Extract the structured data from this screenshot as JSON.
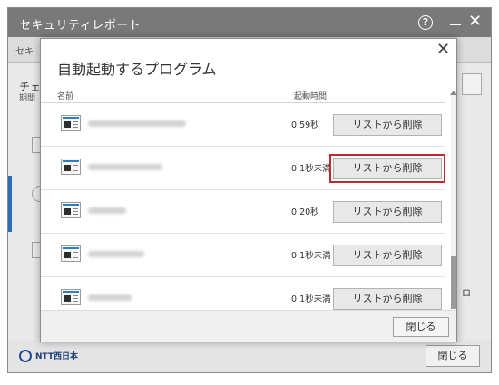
{
  "window": {
    "title": "セキュリティレポート",
    "help_glyph": "?",
    "close_glyph": "✕",
    "background": {
      "tab_label": "セキ",
      "heading": "チェ",
      "subtext": "期間",
      "side_text": "ロ"
    },
    "footer": {
      "brand": "NTT西日本",
      "close_label": "閉じる"
    }
  },
  "dialog": {
    "title": "自動起動するプログラム",
    "close_glyph": "✕",
    "columns": {
      "name": "名前",
      "time": "起動時間"
    },
    "rows": [
      {
        "time": "0.59秒",
        "action": "リストから削除"
      },
      {
        "time": "0.1秒未満",
        "action": "リストから削除"
      },
      {
        "time": "0.20秒",
        "action": "リストから削除"
      },
      {
        "time": "0.1秒未満",
        "action": "リストから削除"
      },
      {
        "time": "0.1秒未満",
        "action": "リストから削除"
      }
    ],
    "close_label": "閉じる"
  },
  "colors": {
    "title_bar": "#797979",
    "focus_outline": "#c4272a",
    "icon_accent": "#2c7fc2",
    "brand_blue": "#1e4c9a"
  }
}
